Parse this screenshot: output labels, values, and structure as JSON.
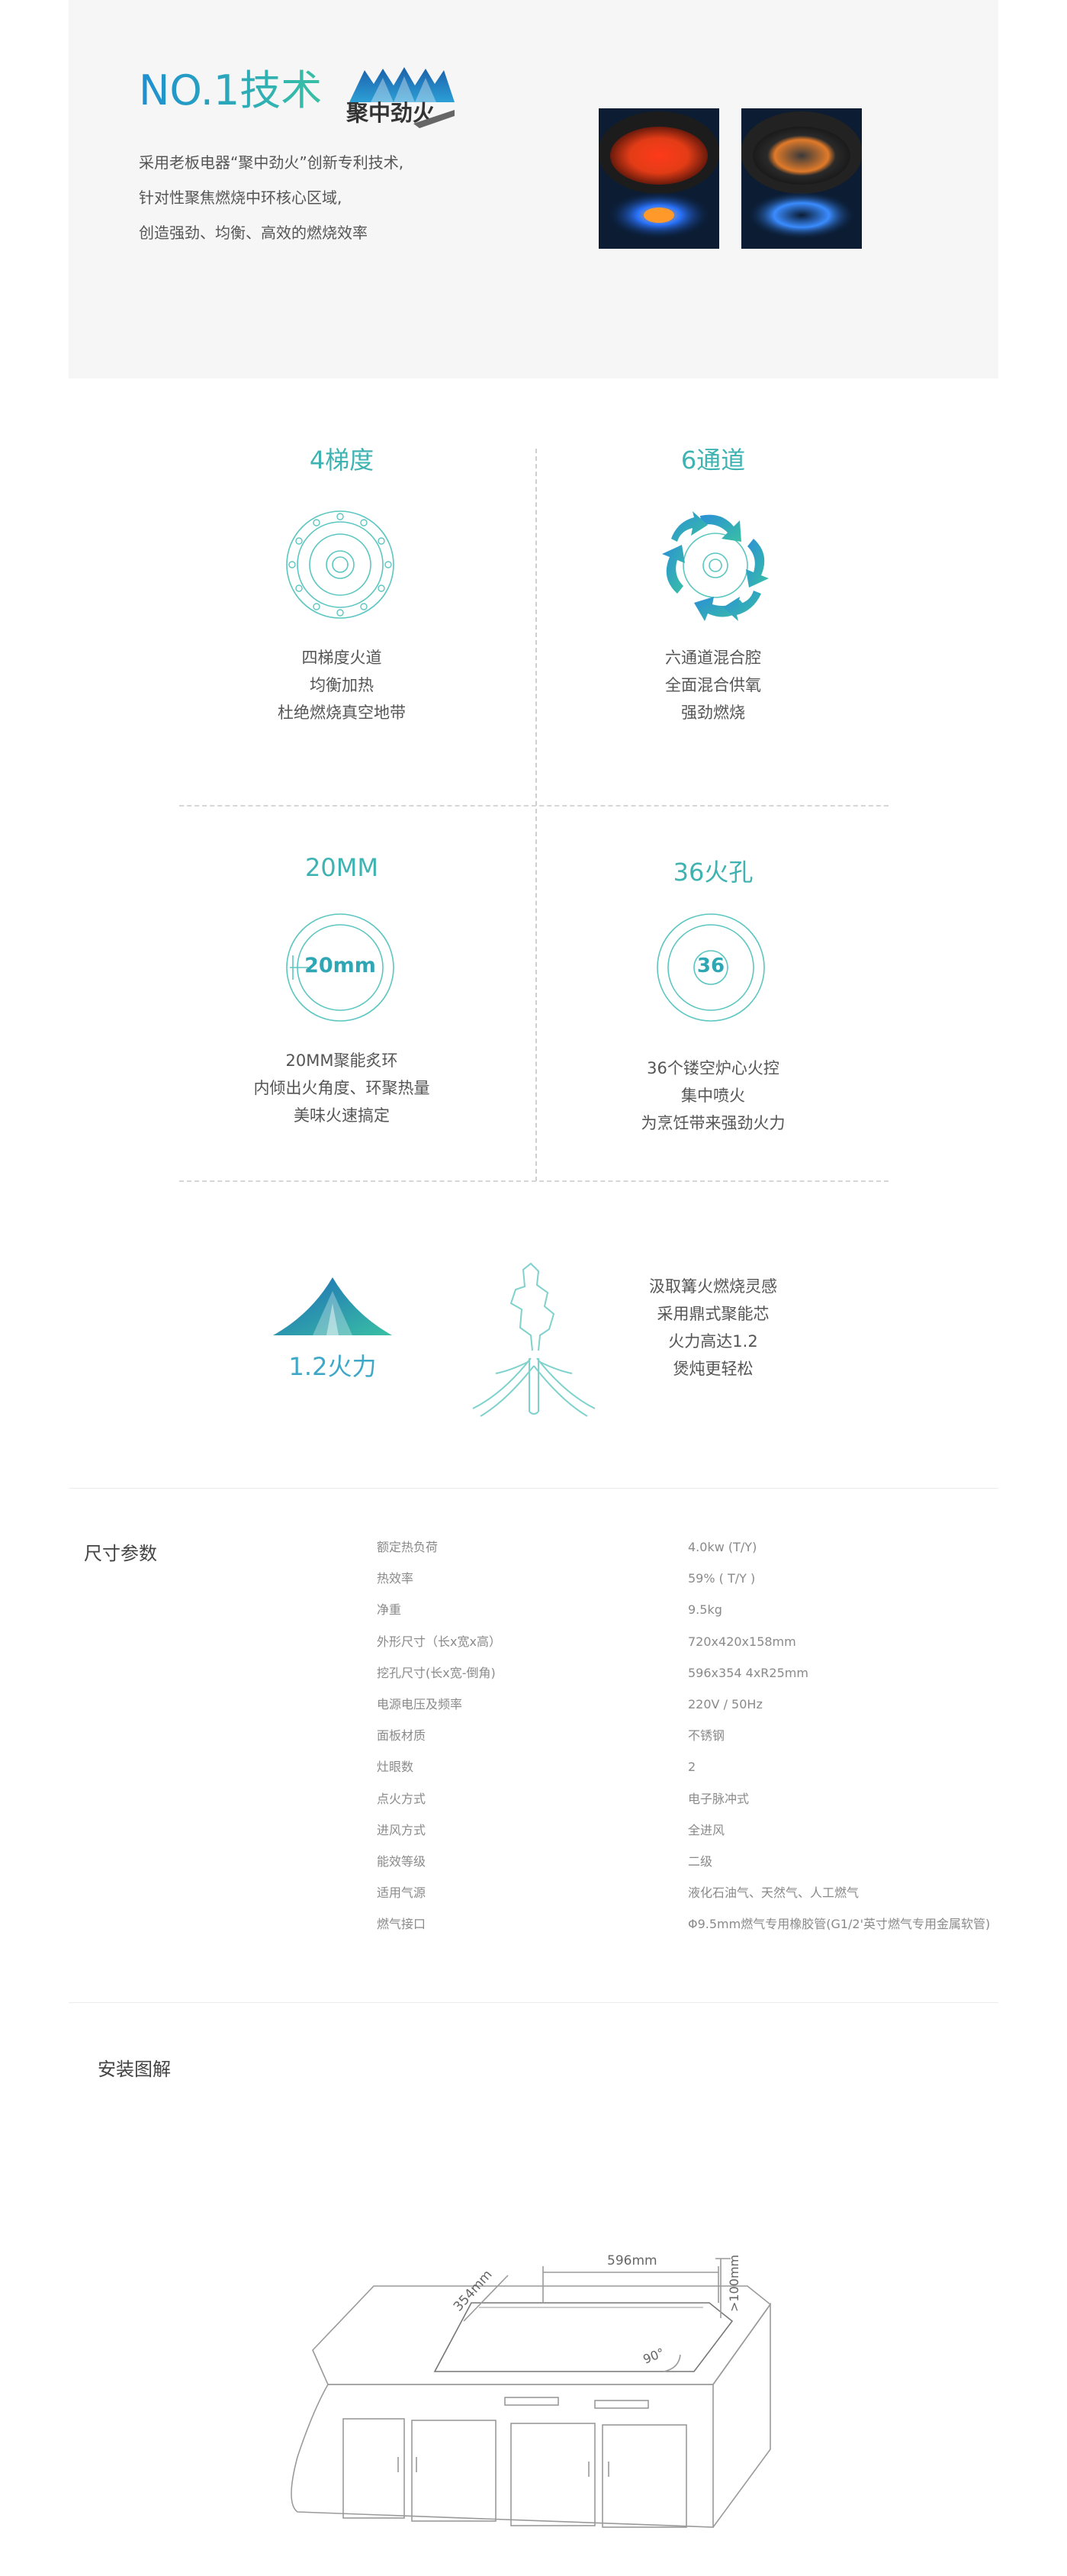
{
  "hero": {
    "title": "NO.1技术",
    "logo_text": "聚中劲火",
    "desc": [
      "采用老板电器“聚中劲火”创新专利技术,",
      "针对性聚焦燃烧中环核心区域,",
      "创造强劲、均衡、高效的燃烧效率"
    ]
  },
  "features": [
    {
      "title": "4梯度",
      "lines": [
        "四梯度火道",
        "均衡加热",
        "杜绝燃烧真空地带"
      ]
    },
    {
      "title": "6通道",
      "lines": [
        "六通道混合腔",
        "全面混合供氧",
        "强劲燃烧"
      ]
    },
    {
      "title": "20MM",
      "icon_text": "20mm",
      "lines": [
        "20MM聚能炙环",
        "内倾出火角度、环聚热量",
        "美味火速搞定"
      ]
    },
    {
      "title": "36火孔",
      "icon_text": "36",
      "lines": [
        "36个镂空炉心火控",
        "集中喷火",
        "为烹饪带来强劲火力"
      ]
    }
  ],
  "power": {
    "label": "1.2火力",
    "lines": [
      "汲取篝火燃烧灵感",
      "采用鼎式聚能芯",
      "火力高达1.2",
      "煲炖更轻松"
    ]
  },
  "specs": {
    "title": "尺寸参数",
    "rows": [
      {
        "label": "额定热负荷",
        "value": "4.0kw (T/Y)"
      },
      {
        "label": "热效率",
        "value": "59% ( T/Y )"
      },
      {
        "label": "净重",
        "value": "9.5kg"
      },
      {
        "label": "外形尺寸（长x宽x高）",
        "value": "720x420x158mm"
      },
      {
        "label": "挖孔尺寸(长x宽-倒角)",
        "value": "596x354 4xR25mm"
      },
      {
        "label": "电源电压及频率",
        "value": "220V / 50Hz"
      },
      {
        "label": "面板材质",
        "value": "不锈钢"
      },
      {
        "label": "灶眼数",
        "value": "2"
      },
      {
        "label": "点火方式",
        "value": "电子脉冲式"
      },
      {
        "label": "进风方式",
        "value": "全进风"
      },
      {
        "label": "能效等级",
        "value": "二级"
      },
      {
        "label": "适用气源",
        "value": "液化石油气、天然气、人工燃气"
      },
      {
        "label": "燃气接口",
        "value": "Φ9.5mm燃气专用橡胶管(G1/2'英寸燃气专用金属软管)"
      }
    ]
  },
  "install": {
    "title": "安装图解",
    "dim_width": "596mm",
    "dim_depth": "354mm",
    "dim_clearance": ">100mm",
    "dim_angle": "90°"
  },
  "colors": {
    "accent": "#3fb3b1",
    "hero_bg": "#f6f6f6",
    "title_blue": "#2a9ad0"
  }
}
